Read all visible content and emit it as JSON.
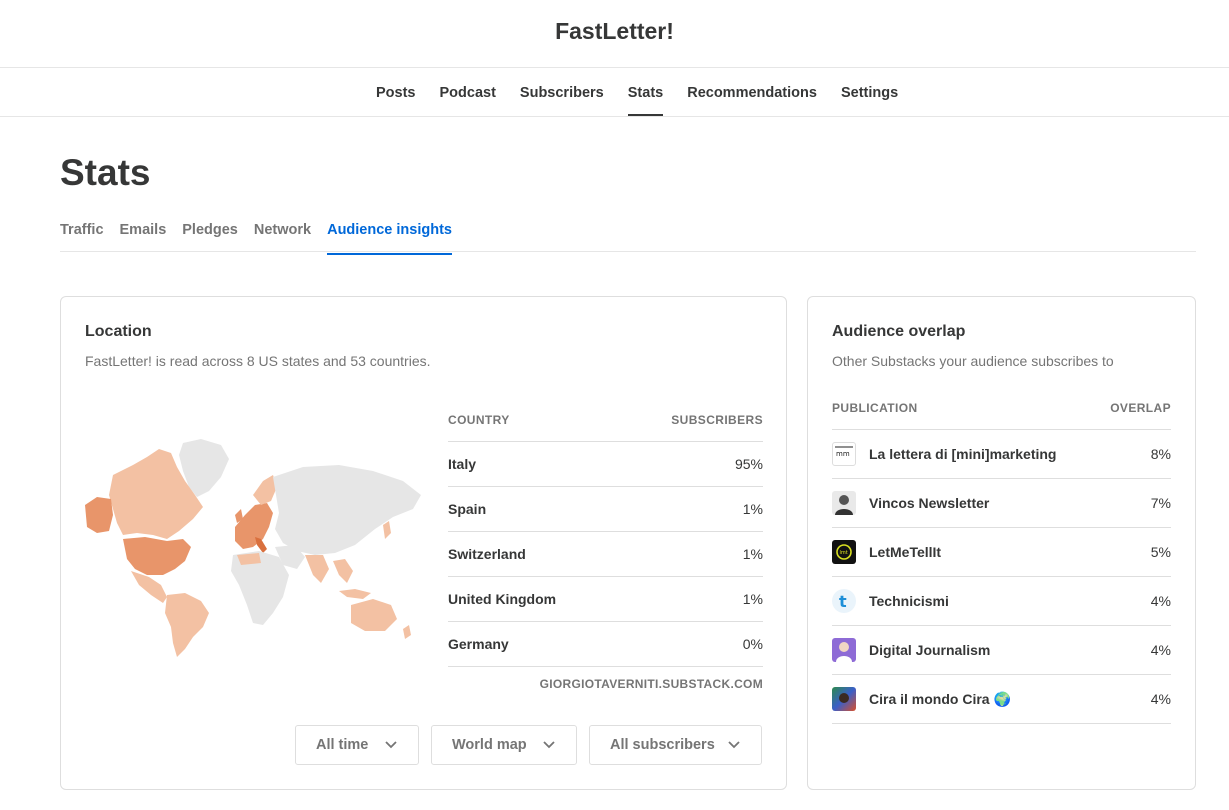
{
  "header": {
    "title": "FastLetter!"
  },
  "nav": {
    "items": [
      {
        "label": "Posts"
      },
      {
        "label": "Podcast"
      },
      {
        "label": "Subscribers"
      },
      {
        "label": "Stats"
      },
      {
        "label": "Recommendations"
      },
      {
        "label": "Settings"
      }
    ],
    "active": "Stats"
  },
  "page": {
    "title": "Stats"
  },
  "subtabs": {
    "items": [
      {
        "label": "Traffic"
      },
      {
        "label": "Emails"
      },
      {
        "label": "Pledges"
      },
      {
        "label": "Network"
      },
      {
        "label": "Audience insights"
      }
    ],
    "active": "Audience insights"
  },
  "location": {
    "title": "Location",
    "subtitle": "FastLetter! is read across 8 US states and 53 countries.",
    "table": {
      "col_country": "COUNTRY",
      "col_subscribers": "SUBSCRIBERS",
      "rows": [
        {
          "country": "Italy",
          "value": "95%"
        },
        {
          "country": "Spain",
          "value": "1%"
        },
        {
          "country": "Switzerland",
          "value": "1%"
        },
        {
          "country": "United Kingdom",
          "value": "1%"
        },
        {
          "country": "Germany",
          "value": "0%"
        }
      ]
    },
    "source": "GIORGIOTAVERNITI.SUBSTACK.COM",
    "filters": {
      "period": "All time",
      "view": "World map",
      "segment": "All subscribers"
    },
    "colors": {
      "map_base": "#e6e6e6",
      "map_low": "#f3c1a3",
      "map_high": "#e8956a"
    }
  },
  "overlap": {
    "title": "Audience overlap",
    "subtitle": "Other Substacks your audience subscribes to",
    "col_publication": "PUBLICATION",
    "col_overlap": "OVERLAP",
    "rows": [
      {
        "name": "La lettera di [mini]marketing",
        "value": "8%",
        "icon": "mm-logo-icon"
      },
      {
        "name": "Vincos Newsletter",
        "value": "7%",
        "icon": "portrait-avatar-icon"
      },
      {
        "name": "LetMeTellIt",
        "value": "5%",
        "icon": "lmt-logo-icon"
      },
      {
        "name": "Technicismi",
        "value": "4%",
        "icon": "t-logo-icon"
      },
      {
        "name": "Digital Journalism",
        "value": "4%",
        "icon": "portrait-avatar-icon"
      },
      {
        "name": "Cira il mondo Cira 🌍",
        "value": "4%",
        "icon": "photo-avatar-icon"
      }
    ]
  }
}
